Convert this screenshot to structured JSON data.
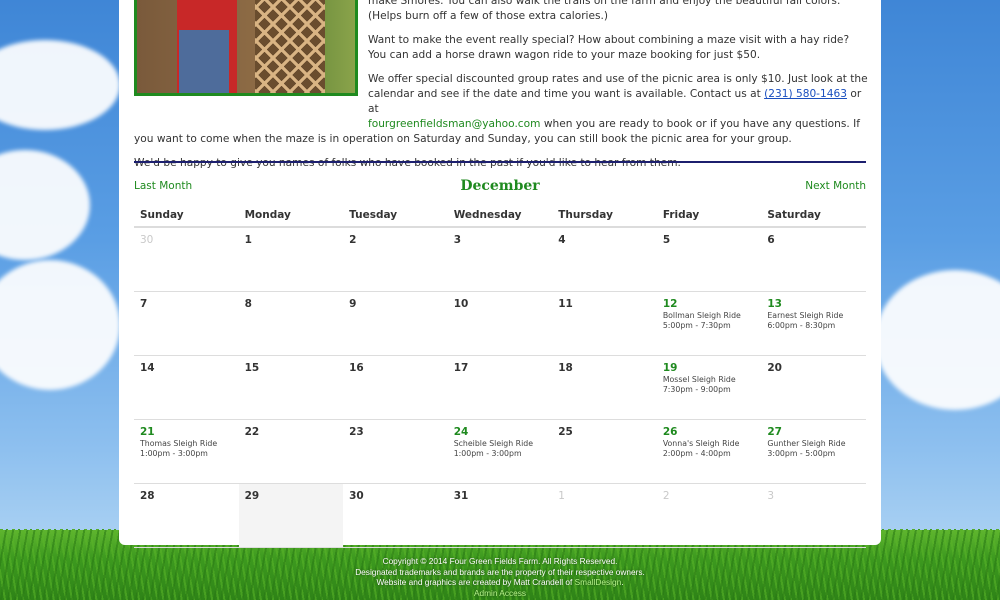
{
  "content": {
    "para1_tail": "make Smores. You can also walk the trails on the farm and enjoy the beautiful fall colors. (Helps burn off a few of those extra calories.)",
    "para2": "Want to make the event really special? How about combining a maze visit with a hay ride? You can add a horse drawn wagon ride to your maze booking for just $50.",
    "para3_a": "We offer special discounted group rates and use of the picnic area is only $10. Just look at the calendar and see if the date and time you want is available. Contact us at",
    "phone": "(231) 580-1463",
    "para3_b": "or at",
    "email": "fourgreenfieldsman@yahoo.com",
    "para3_c": "when you are ready to book or if you have any questions. If you want to come when the maze is in operation on Saturday and Sunday, you can still book the picnic area for your group.",
    "para4": "We'd be happy to give you names of folks who have booked in the past if you'd like to hear from them."
  },
  "calendar": {
    "prev_label": "Last Month",
    "next_label": "Next Month",
    "month": "December",
    "weekdays": [
      "Sunday",
      "Monday",
      "Tuesday",
      "Wednesday",
      "Thursday",
      "Friday",
      "Saturday"
    ],
    "weeks": [
      [
        {
          "day": "30",
          "muted": true
        },
        {
          "day": "1"
        },
        {
          "day": "2"
        },
        {
          "day": "3"
        },
        {
          "day": "4"
        },
        {
          "day": "5"
        },
        {
          "day": "6"
        }
      ],
      [
        {
          "day": "7"
        },
        {
          "day": "8"
        },
        {
          "day": "9"
        },
        {
          "day": "10"
        },
        {
          "day": "11"
        },
        {
          "day": "12",
          "event": "Bollman Sleigh Ride",
          "time": "5:00pm - 7:30pm"
        },
        {
          "day": "13",
          "event": "Earnest Sleigh Ride",
          "time": "6:00pm - 8:30pm"
        }
      ],
      [
        {
          "day": "14"
        },
        {
          "day": "15"
        },
        {
          "day": "16"
        },
        {
          "day": "17"
        },
        {
          "day": "18"
        },
        {
          "day": "19",
          "event": "Mossel Sleigh Ride",
          "time": "7:30pm - 9:00pm"
        },
        {
          "day": "20"
        }
      ],
      [
        {
          "day": "21",
          "event": "Thomas Sleigh Ride",
          "time": "1:00pm - 3:00pm"
        },
        {
          "day": "22"
        },
        {
          "day": "23"
        },
        {
          "day": "24",
          "event": "Scheible Sleigh Ride",
          "time": "1:00pm - 3:00pm"
        },
        {
          "day": "25"
        },
        {
          "day": "26",
          "event": "Vonna's Sleigh Ride",
          "time": "2:00pm - 4:00pm"
        },
        {
          "day": "27",
          "event": "Gunther Sleigh Ride",
          "time": "3:00pm - 5:00pm"
        }
      ],
      [
        {
          "day": "28"
        },
        {
          "day": "29",
          "today": true
        },
        {
          "day": "30"
        },
        {
          "day": "31"
        },
        {
          "day": "1",
          "muted": true
        },
        {
          "day": "2",
          "muted": true
        },
        {
          "day": "3",
          "muted": true
        }
      ]
    ]
  },
  "footer": {
    "copyright": "Copyright © 2014 Four Green Fields Farm. All Rights Reserved.",
    "trademarks": "Designated trademarks and brands are the property of their respective owners.",
    "credit_prefix": "Website and graphics are created by Matt Crandell of",
    "credit_link": "SmallDesign",
    "credit_suffix": ".",
    "admin": "Admin Access"
  }
}
